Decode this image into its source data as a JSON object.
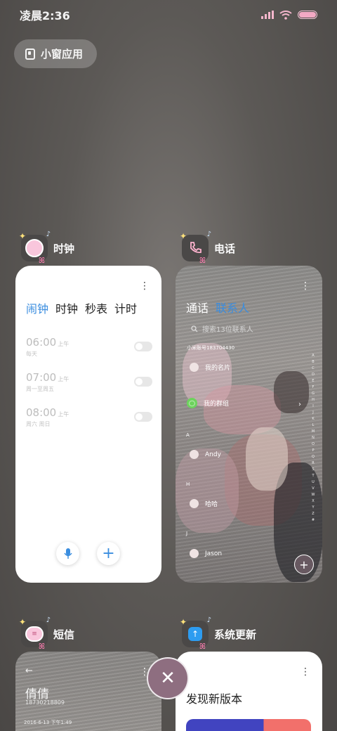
{
  "status_bar": {
    "time": "凌晨2:36",
    "icons": [
      "signal-icon",
      "wifi-icon",
      "battery-icon"
    ],
    "accent": "#f3a9c4"
  },
  "mini_window": {
    "label": "小窗应用",
    "icon": "mini-window-icon"
  },
  "apps": [
    {
      "name": "时钟",
      "icon": "clock-app-icon"
    },
    {
      "name": "电话",
      "icon": "phone-app-icon"
    },
    {
      "name": "短信",
      "icon": "messages-app-icon"
    },
    {
      "name": "系统更新",
      "icon": "system-update-app-icon"
    }
  ],
  "clock": {
    "tabs": [
      "闹钟",
      "时钟",
      "秒表",
      "计时"
    ],
    "active_tab": "闹钟",
    "alarms": [
      {
        "time": "06:00",
        "ampm": "上午",
        "days": "每天"
      },
      {
        "time": "07:00",
        "ampm": "上午",
        "days": "周一至周五"
      },
      {
        "time": "08:00",
        "ampm": "上午",
        "days": "周六 周日"
      }
    ],
    "accent": "#3a8ddf"
  },
  "phone": {
    "tabs": [
      "通话",
      "联系人"
    ],
    "active_tab": "联系人",
    "search_placeholder": "搜索13位联系人",
    "account": "小米账号183704430",
    "my_card": "我的名片",
    "my_group": "我的群组",
    "sections": [
      {
        "letter": "A",
        "contact": "Andy"
      },
      {
        "letter": "H",
        "contact": "哈哈"
      },
      {
        "letter": "J",
        "contact": "Jason"
      }
    ],
    "alpha_index": [
      "A",
      "B",
      "C",
      "D",
      "E",
      "F",
      "G",
      "H",
      "I",
      "J",
      "K",
      "L",
      "M",
      "N",
      "O",
      "P",
      "Q",
      "R",
      "S",
      "T",
      "U",
      "V",
      "W",
      "X",
      "Y",
      "Z",
      "#"
    ]
  },
  "messages": {
    "contact_name": "倩倩",
    "number": "18730218809",
    "date": "2016-6-13 下午1:49"
  },
  "update": {
    "title": "发现新版本"
  },
  "close_all": {
    "icon": "close-icon"
  }
}
